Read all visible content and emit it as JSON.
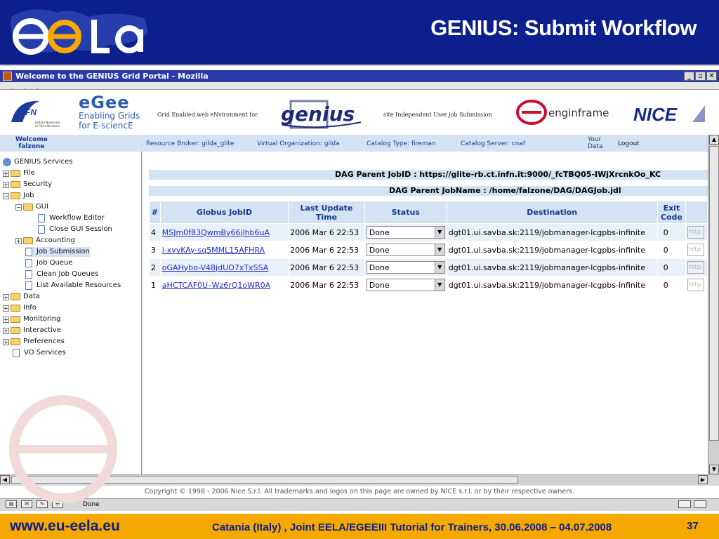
{
  "slide": {
    "title": "GENIUS: Submit Workflow",
    "footer_url": "www.eu-eela.eu",
    "footer_event": "Catania (Italy) , Joint EELA/EGEEIII Tutorial for Trainers, 30.06.2008 – 04.07.2008",
    "page_number": "37",
    "colors": {
      "header_bg": "#0d1f8c",
      "footer_bg": "#f5a800",
      "accent_text": "#0d1f8c"
    }
  },
  "browser": {
    "window_title": "Welcome to the GENIUS Grid Portal - Mozilla",
    "status_text": "Done",
    "copyright": "Copyright © 1998 - 2006 Nice S.r.l. All trademarks and logos on this page are owned by NICE s.r.l. or by their respective owners."
  },
  "banner": {
    "infn_text": "INFN",
    "infn_sub": "Istituto Nazionale di Fisica Nucleare",
    "egee_word": "eGee",
    "egee_line1": "Enabling Grids",
    "egee_line2": "for E-sciencE",
    "grid_caption": "Grid Enabled web eNvironment for",
    "genius_logo": "genius",
    "site_caption": "site Independent User job Submission",
    "engframe_logo": "enginframe",
    "nice_logo": "NICE"
  },
  "infobar": {
    "welcome": "Welcome",
    "user": "falzone",
    "resource_broker": "Resource Broker: gilda_glite",
    "vo": "Virtual Organization: gilda",
    "catalog_type": "Catalog Type: fireman",
    "catalog_server": "Catalog Server: cnaf",
    "your_data_1": "Your",
    "your_data_2": "Data",
    "logout": "Logout"
  },
  "sidebar": {
    "root": "GENIUS Services",
    "items": [
      {
        "label": "File"
      },
      {
        "label": "Security"
      },
      {
        "label": "Job"
      },
      {
        "label": "GUI"
      },
      {
        "label": "Workflow Editor"
      },
      {
        "label": "Close GUI Session"
      },
      {
        "label": "Accounting"
      },
      {
        "label": "Job Submission"
      },
      {
        "label": "Job Queue"
      },
      {
        "label": "Clean Job Queues"
      },
      {
        "label": "List Available Resources"
      },
      {
        "label": "Data"
      },
      {
        "label": "Info"
      },
      {
        "label": "Monitoring"
      },
      {
        "label": "Interactive"
      },
      {
        "label": "Preferences"
      },
      {
        "label": "VO Services"
      }
    ]
  },
  "dag": {
    "parent_jobid": "DAG Parent JobID : https://glite-rb.ct.infn.it:9000/_fcTBQ05-IWjXrcnkOo_KC",
    "parent_jobname": "DAG Parent JobName : /home/falzone/DAG/DAGJob.jdl"
  },
  "jobs_table": {
    "headers": [
      "#",
      "Globus JobID",
      "Last Update Time",
      "Status",
      "Destination",
      "Exit Code"
    ],
    "rows": [
      {
        "num": "4",
        "jobid": "MSJm0f83QwmBy66jlhb6uA",
        "time": "2006 Mar 6 22:53",
        "status": "Done",
        "dest": "dgt01.ui.savba.sk:2119/jobmanager-lcgpbs-infinite",
        "exit": "0",
        "out": "http"
      },
      {
        "num": "3",
        "jobid": "i-xyvKAy-sq5MML15AFHRA",
        "time": "2006 Mar 6 22:53",
        "status": "Done",
        "dest": "dgt01.ui.savba.sk:2119/jobmanager-lcgpbs-infinite",
        "exit": "0",
        "out": "http"
      },
      {
        "num": "2",
        "jobid": "oGAHybo-V48jdUO7xTxSSA",
        "time": "2006 Mar 6 22:53",
        "status": "Done",
        "dest": "dgt01.ui.savba.sk:2119/jobmanager-lcgpbs-infinite",
        "exit": "0",
        "out": "http"
      },
      {
        "num": "1",
        "jobid": "aHCTCAF0U–Wz6rQ1oWR0A",
        "time": "2006 Mar 6 22:53",
        "status": "Done",
        "dest": "dgt01.ui.savba.sk:2119/jobmanager-lcgpbs-infinite",
        "exit": "0",
        "out": "http"
      }
    ]
  }
}
